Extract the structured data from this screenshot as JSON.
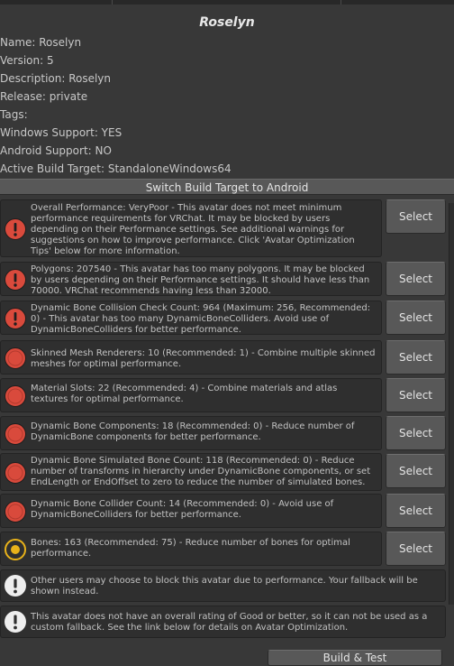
{
  "title": "Roselyn",
  "info": {
    "name": "Name: Roselyn",
    "version": "Version: 5",
    "description": "Description: Roselyn",
    "release": "Release: private",
    "tags": "Tags:",
    "windows_support": "Windows Support: YES",
    "android_support": "Android Support: NO",
    "active_build_target": "Active Build Target: StandaloneWindows64"
  },
  "switch_button": "Switch Build Target to Android",
  "select_label": "Select",
  "messages": [
    {
      "icon": "error-icon",
      "text": "Overall Performance: VeryPoor - This avatar does not meet minimum performance requirements for VRChat. It may be blocked by users depending on their Performance settings. See additional warnings for suggestions on how to improve performance. Click 'Avatar Optimization Tips' below for more information."
    },
    {
      "icon": "error-icon",
      "text": "Polygons: 207540 - This avatar has too many polygons. It may be blocked by users depending on their Performance settings. It should have less than 70000. VRChat recommends having less than 32000."
    },
    {
      "icon": "error-icon",
      "text": "Dynamic Bone Collision Check Count: 964 (Maximum: 256, Recommended: 0) - This avatar has too many DynamicBoneColliders. Avoid use of DynamicBoneColliders for better performance."
    },
    {
      "icon": "red-circle-icon",
      "text": "Skinned Mesh Renderers: 10 (Recommended: 1) - Combine multiple skinned meshes for optimal performance."
    },
    {
      "icon": "red-circle-icon",
      "text": "Material Slots: 22 (Recommended: 4) - Combine materials and atlas textures for optimal performance."
    },
    {
      "icon": "red-circle-icon",
      "text": "Dynamic Bone Components: 18 (Recommended: 0) - Reduce number of DynamicBone components for better performance."
    },
    {
      "icon": "red-circle-icon",
      "text": "Dynamic Bone Simulated Bone Count: 118 (Recommended: 0) - Reduce number of transforms in hierarchy under DynamicBone components, or set EndLength or EndOffset to zero to reduce the number of simulated bones."
    },
    {
      "icon": "red-circle-icon",
      "text": "Dynamic Bone Collider Count: 14 (Recommended: 0) - Avoid use of DynamicBoneColliders for better performance."
    },
    {
      "icon": "yellow-circle-icon",
      "text": "Bones: 163 (Recommended: 75) - Reduce number of bones for optimal performance."
    }
  ],
  "notices": [
    {
      "icon": "warning-icon",
      "text": "Other users may choose to block this avatar due to performance. Your fallback will be shown instead."
    },
    {
      "icon": "warning-icon",
      "text": "This avatar does not have an overall rating of Good or better, so it can not be used as a custom fallback. See the link below for details on Avatar Optimization."
    }
  ],
  "build_button": "Build & Test",
  "colors": {
    "error": "#d94a3c",
    "warning_yellow": "#e8b21a",
    "panel": "#383838",
    "button": "#585858"
  }
}
